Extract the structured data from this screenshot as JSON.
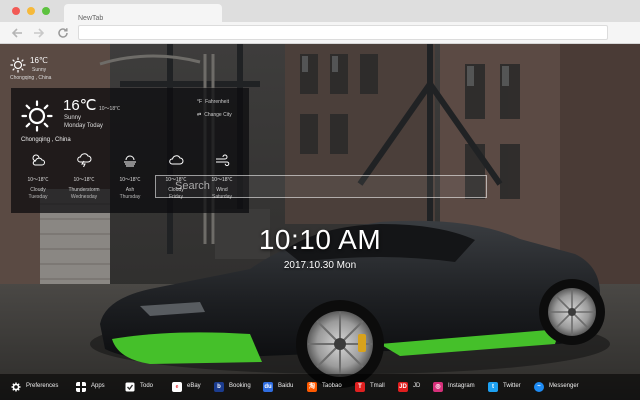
{
  "browser": {
    "tab_title": "NewTab"
  },
  "mini_weather": {
    "temp": "16℃",
    "condition": "Sunny",
    "city": "Chongqing , China"
  },
  "weather": {
    "temp": "16℃",
    "range": "10～18℃",
    "condition": "Sunny",
    "day": "Monday Today",
    "city": "Chongqing , China",
    "unit_toggle": "Fahrenheit",
    "change_city": "Change City",
    "forecast": [
      {
        "range": "10～18℃",
        "condition": "Cloudy",
        "day": "Tuesday",
        "icon": "cloudy-sun-icon"
      },
      {
        "range": "10～18℃",
        "condition": "Thunderstorm",
        "day": "Wednesday",
        "icon": "thunderstorm-icon"
      },
      {
        "range": "10～18℃",
        "condition": "Ash",
        "day": "Thursday",
        "icon": "haze-icon"
      },
      {
        "range": "10～18℃",
        "condition": "Cloudy",
        "day": "Friday",
        "icon": "cloud-icon"
      },
      {
        "range": "10～18℃",
        "condition": "Wind",
        "day": "Saturday",
        "icon": "wind-icon"
      }
    ]
  },
  "search": {
    "placeholder": "Search"
  },
  "clock": {
    "time": "10:10 AM",
    "date": "2017.10.30 Mon"
  },
  "bottom_bar": [
    {
      "label": "Preferences",
      "icon": "gear-icon",
      "color": "transparent"
    },
    {
      "label": "Apps",
      "icon": "apps-grid-icon",
      "color": "transparent"
    },
    {
      "label": "Todo",
      "icon": "checkbox-icon",
      "color": "#ffffff"
    },
    {
      "label": "eBay",
      "icon": "ebay-icon",
      "color": "#ffffff"
    },
    {
      "label": "Booking",
      "icon": "booking-icon",
      "color": "#1b3c8f"
    },
    {
      "label": "Baidu",
      "icon": "baidu-icon",
      "color": "#2f6de0"
    },
    {
      "label": "Taobao",
      "icon": "taobao-icon",
      "color": "#ff5a00"
    },
    {
      "label": "Tmall",
      "icon": "tmall-icon",
      "color": "#e02020"
    },
    {
      "label": "JD",
      "icon": "jd-icon",
      "color": "#e01e1e"
    },
    {
      "label": "Instagram",
      "icon": "instagram-icon",
      "color": "#d6307a"
    },
    {
      "label": "Twitter",
      "icon": "twitter-icon",
      "color": "#1da1f2"
    },
    {
      "label": "Messenger",
      "icon": "messenger-icon",
      "color": "#1e8cf5"
    }
  ]
}
